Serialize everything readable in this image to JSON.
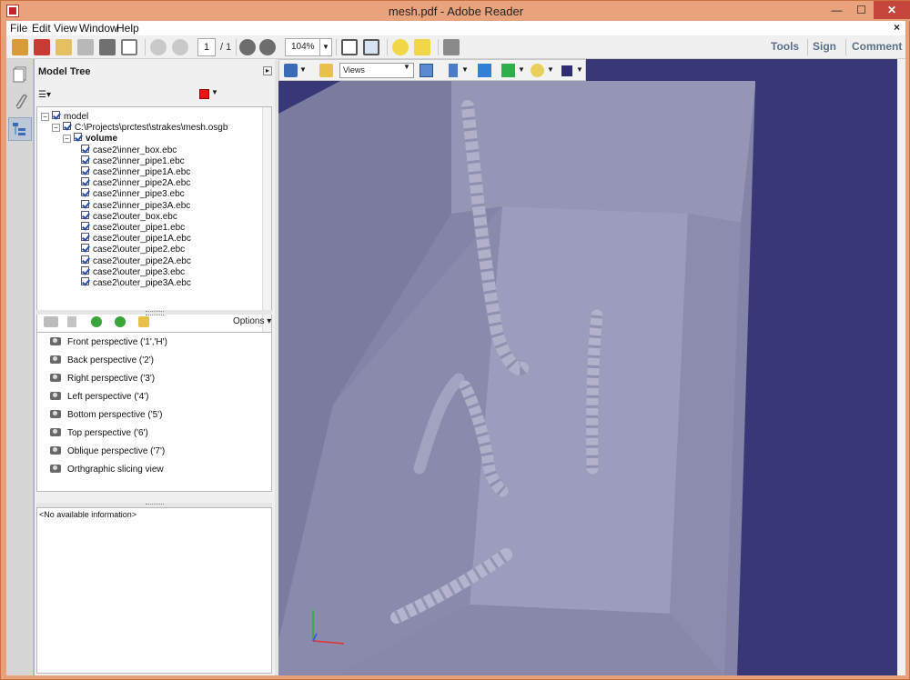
{
  "window": {
    "title": "mesh.pdf - Adobe Reader",
    "controls": {
      "minimize": "—",
      "maximize": "☐",
      "close": "✕"
    }
  },
  "menu": {
    "items": [
      "File",
      "Edit",
      "View",
      "Window",
      "Help"
    ],
    "close_doc": "×"
  },
  "toolbar": {
    "page_current": "1",
    "page_total": "/ 1",
    "zoom": "104%",
    "right_links": [
      "Tools",
      "Sign",
      "Comment"
    ]
  },
  "model_tree": {
    "title": "Model Tree",
    "color_swatch": "#ee1111",
    "nodes": [
      {
        "label": "model",
        "level": 0,
        "expander": "−",
        "bold": false
      },
      {
        "label": "C:\\Projects\\prctest\\strakes\\mesh.osgb",
        "level": 1,
        "expander": "−",
        "bold": false
      },
      {
        "label": "volume",
        "level": 2,
        "expander": "−",
        "bold": true
      },
      {
        "label": "case2\\inner_box.ebc",
        "level": 3
      },
      {
        "label": "case2\\inner_pipe1.ebc",
        "level": 3
      },
      {
        "label": "case2\\inner_pipe1A.ebc",
        "level": 3
      },
      {
        "label": "case2\\inner_pipe2A.ebc",
        "level": 3
      },
      {
        "label": "case2\\inner_pipe3.ebc",
        "level": 3
      },
      {
        "label": "case2\\inner_pipe3A.ebc",
        "level": 3
      },
      {
        "label": "case2\\outer_box.ebc",
        "level": 3
      },
      {
        "label": "case2\\outer_pipe1.ebc",
        "level": 3
      },
      {
        "label": "case2\\outer_pipe1A.ebc",
        "level": 3
      },
      {
        "label": "case2\\outer_pipe2.ebc",
        "level": 3
      },
      {
        "label": "case2\\outer_pipe2A.ebc",
        "level": 3
      },
      {
        "label": "case2\\outer_pipe3.ebc",
        "level": 3
      },
      {
        "label": "case2\\outer_pipe3A.ebc",
        "level": 3
      }
    ]
  },
  "views_panel": {
    "options_label": "Options ▾",
    "views": [
      "Front perspective ('1','H')",
      "Back perspective ('2')",
      "Right perspective ('3')",
      "Left perspective ('4')",
      "Bottom perspective ('5')",
      "Top perspective ('6')",
      "Oblique perspective ('7')",
      "Orthgraphic slicing view"
    ]
  },
  "info_panel": {
    "text": "<No available information>"
  },
  "viewport_toolbar": {
    "views_select": "Views",
    "background_color": "#383878",
    "model_color": "#a9a9c6"
  }
}
